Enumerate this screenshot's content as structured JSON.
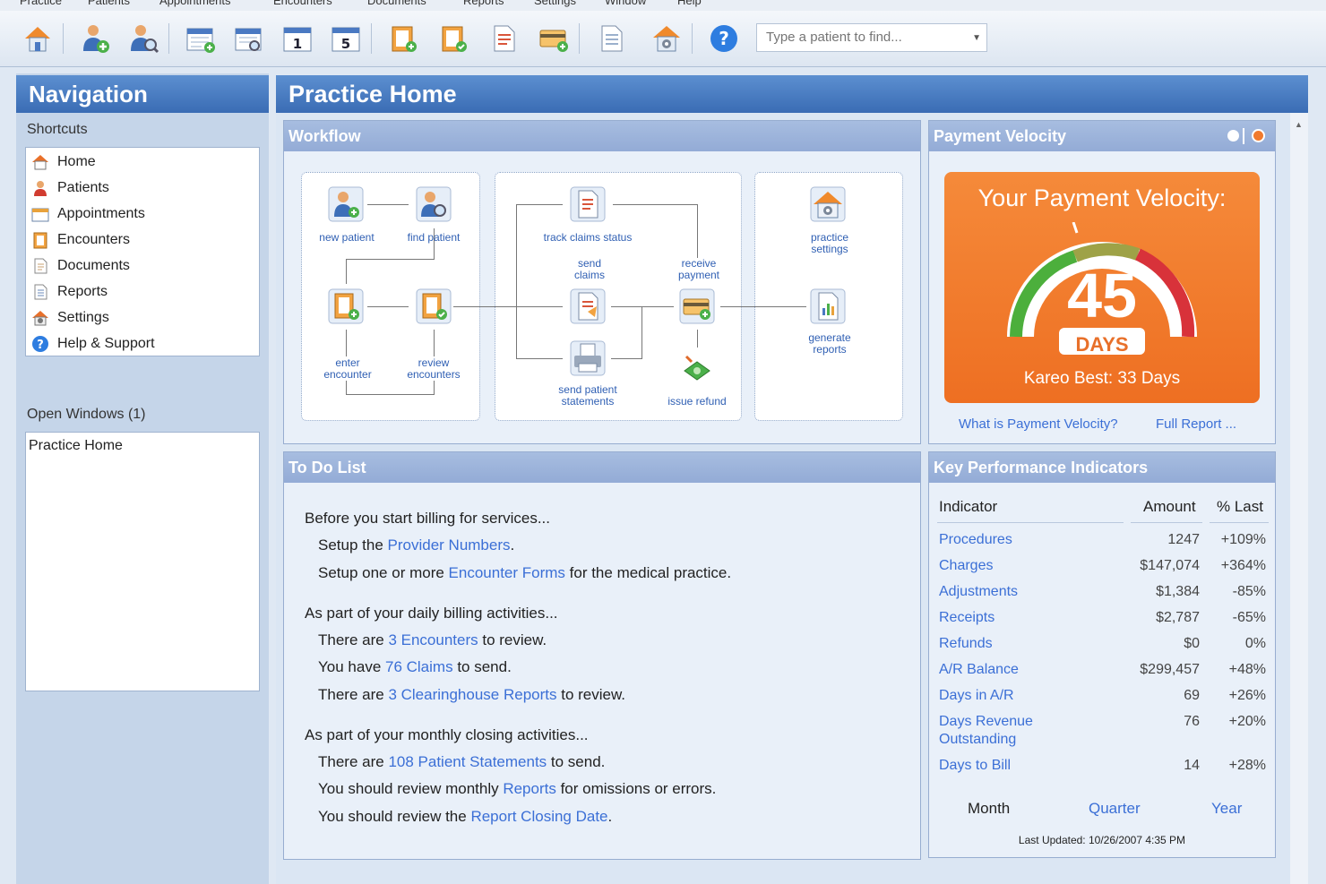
{
  "menu": [
    "Practice",
    "Patients",
    "Appointments",
    "Encounters",
    "Documents",
    "Reports",
    "Settings",
    "Window",
    "Help"
  ],
  "search": {
    "placeholder": "Type a patient to find..."
  },
  "navigation": {
    "title": "Navigation",
    "shortcuts_label": "Shortcuts",
    "shortcuts": [
      "Home",
      "Patients",
      "Appointments",
      "Encounters",
      "Documents",
      "Reports",
      "Settings",
      "Help & Support"
    ],
    "open_windows_label": "Open Windows (1)",
    "open_windows": [
      "Practice Home"
    ]
  },
  "main": {
    "title": "Practice Home"
  },
  "workflow": {
    "title": "Workflow",
    "labels": {
      "new_patient": "new patient",
      "find_patient": "find patient",
      "enter_encounter_1": "enter",
      "enter_encounter_2": "encounter",
      "review_encounters_1": "review",
      "review_encounters_2": "encounters",
      "track": "track claims status",
      "send_claims_1": "send",
      "send_claims_2": "claims",
      "receive_1": "receive",
      "receive_2": "payment",
      "send_stmt_1": "send patient",
      "send_stmt_2": "statements",
      "issue_refund": "issue refund",
      "practice_settings_1": "practice",
      "practice_settings_2": "settings",
      "generate_reports_1": "generate",
      "generate_reports_2": "reports"
    }
  },
  "velocity": {
    "title": "Payment Velocity",
    "heading": "Your Payment Velocity:",
    "days": "45",
    "days_label": "DAYS",
    "best": "Kareo Best: 33 Days",
    "link_what": "What is Payment Velocity?",
    "link_full": "Full Report ...",
    "colors": {
      "orange": "#f07a2e",
      "green": "#4caf3c",
      "red": "#d8323a"
    }
  },
  "todo": {
    "title": "To Do List",
    "billing_intro": "Before you start billing for services...",
    "l1a": "Setup the ",
    "l1b": "Provider Numbers",
    "l1c": ".",
    "l2a": "Setup one or more ",
    "l2b": "Encounter Forms",
    "l2c": " for the medical practice.",
    "daily_intro": "As part of your daily billing activities...",
    "l3a": "There are ",
    "l3b": "3 Encounters",
    "l3c": " to review.",
    "l4a": "You have ",
    "l4b": "76 Claims",
    "l4c": " to send.",
    "l5a": "There are ",
    "l5b": "3 Clearinghouse Reports",
    "l5c": " to review.",
    "monthly_intro": "As part of your monthly closing activities...",
    "l6a": "There are ",
    "l6b": "108 Patient Statements",
    "l6c": " to send.",
    "l7a": "You should review monthly ",
    "l7b": "Reports",
    "l7c": " for omissions or errors.",
    "l8a": "You should review the ",
    "l8b": "Report Closing Date",
    "l8c": "."
  },
  "kpi": {
    "title": "Key Performance Indicators",
    "headers": [
      "Indicator",
      "Amount",
      "% Last"
    ],
    "rows": [
      {
        "name": "Procedures",
        "amount": "1247",
        "pct": "+109%"
      },
      {
        "name": "Charges",
        "amount": "$147,074",
        "pct": "+364%"
      },
      {
        "name": "Adjustments",
        "amount": "$1,384",
        "pct": "-85%"
      },
      {
        "name": "Receipts",
        "amount": "$2,787",
        "pct": "-65%"
      },
      {
        "name": "Refunds",
        "amount": "$0",
        "pct": "0%"
      },
      {
        "name": "A/R Balance",
        "amount": "$299,457",
        "pct": "+48%"
      },
      {
        "name": "Days in A/R",
        "amount": "69",
        "pct": "+26%"
      },
      {
        "name": "Days Revenue",
        "name2": "Outstanding",
        "amount": "76",
        "pct": "+20%"
      },
      {
        "name": "Days to Bill",
        "amount": "14",
        "pct": "+28%"
      }
    ],
    "periods": [
      "Month",
      "Quarter",
      "Year"
    ],
    "updated": "Last Updated: 10/26/2007 4:35 PM"
  }
}
